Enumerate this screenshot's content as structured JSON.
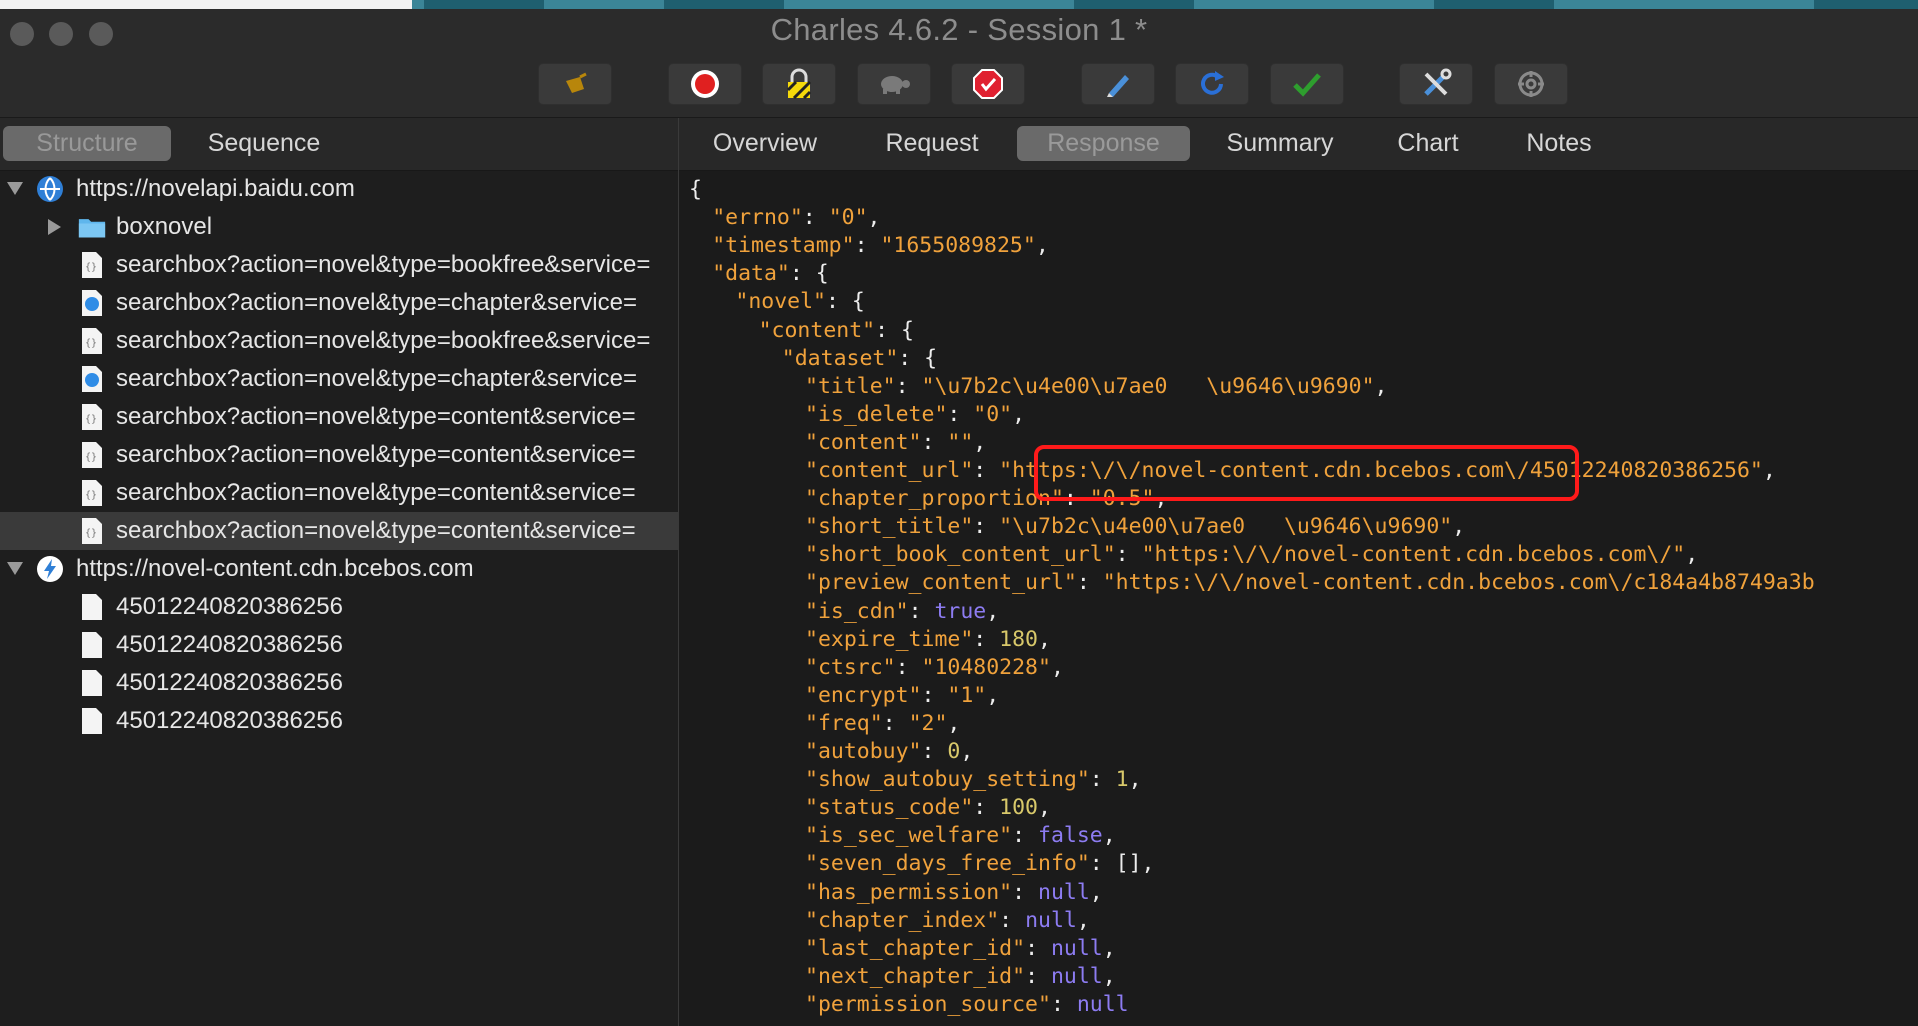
{
  "window": {
    "title": "Charles 4.6.2 - Session 1 *"
  },
  "toolbar": {
    "buttons": [
      {
        "name": "broom-icon",
        "color": "#b8860b"
      },
      {
        "name": "record-icon",
        "color": "#e02020"
      },
      {
        "name": "ssl-proxy-lock-icon",
        "color": "#f5d90a"
      },
      {
        "name": "throttle-turtle-icon",
        "color": "#7a7a7a"
      },
      {
        "name": "breakpoints-stop-icon",
        "color": "#e02030"
      },
      {
        "name": "compose-pen-icon",
        "color": "#4a90d9"
      },
      {
        "name": "repeat-refresh-icon",
        "color": "#2a6fd6"
      },
      {
        "name": "validate-check-icon",
        "color": "#2e9e2e"
      },
      {
        "name": "tools-icon",
        "color": "#4a90d9"
      },
      {
        "name": "settings-gear-icon",
        "color": "#8a8a8a"
      }
    ]
  },
  "left": {
    "tabs": [
      {
        "label": "Structure",
        "active": true
      },
      {
        "label": "Sequence",
        "active": false
      }
    ],
    "tree": [
      {
        "level": 0,
        "label": "https://novelapi.baidu.com",
        "icon": "globe-icon",
        "expanded": true
      },
      {
        "level": 1,
        "label": "boxnovel",
        "icon": "folder-icon",
        "expanded": false
      },
      {
        "level": 1,
        "label": "searchbox?action=novel&type=bookfree&service=",
        "icon": "json-file-icon"
      },
      {
        "level": 1,
        "label": "searchbox?action=novel&type=chapter&service=",
        "icon": "pending-request-icon"
      },
      {
        "level": 1,
        "label": "searchbox?action=novel&type=bookfree&service=",
        "icon": "json-file-icon"
      },
      {
        "level": 1,
        "label": "searchbox?action=novel&type=chapter&service=",
        "icon": "pending-request-icon"
      },
      {
        "level": 1,
        "label": "searchbox?action=novel&type=content&service=",
        "icon": "json-file-icon"
      },
      {
        "level": 1,
        "label": "searchbox?action=novel&type=content&service=",
        "icon": "json-file-icon"
      },
      {
        "level": 1,
        "label": "searchbox?action=novel&type=content&service=",
        "icon": "json-file-icon"
      },
      {
        "level": 1,
        "label": "searchbox?action=novel&type=content&service=",
        "icon": "json-file-icon",
        "selected": true
      },
      {
        "level": 0,
        "label": "https://novel-content.cdn.bcebos.com",
        "icon": "bolt-icon",
        "expanded": true
      },
      {
        "level": 1,
        "label": "45012240820386256",
        "icon": "file-icon"
      },
      {
        "level": 1,
        "label": "45012240820386256",
        "icon": "file-icon"
      },
      {
        "level": 1,
        "label": "45012240820386256",
        "icon": "file-icon"
      },
      {
        "level": 1,
        "label": "45012240820386256",
        "icon": "file-icon"
      }
    ]
  },
  "right": {
    "tabs": [
      {
        "label": "Overview",
        "active": false
      },
      {
        "label": "Request",
        "active": false
      },
      {
        "label": "Response",
        "active": true
      },
      {
        "label": "Summary",
        "active": false
      },
      {
        "label": "Chart",
        "active": false
      },
      {
        "label": "Notes",
        "active": false
      }
    ],
    "json_lines": [
      {
        "indent": 0,
        "tokens": [
          [
            "p",
            "{"
          ]
        ]
      },
      {
        "indent": 1,
        "tokens": [
          [
            "k",
            "\"errno\""
          ],
          [
            "p",
            ": "
          ],
          [
            "s",
            "\"0\""
          ],
          [
            "p",
            ","
          ]
        ]
      },
      {
        "indent": 1,
        "tokens": [
          [
            "k",
            "\"timestamp\""
          ],
          [
            "p",
            ": "
          ],
          [
            "s",
            "\"1655089825\""
          ],
          [
            "p",
            ","
          ]
        ]
      },
      {
        "indent": 1,
        "tokens": [
          [
            "k",
            "\"data\""
          ],
          [
            "p",
            ": {"
          ]
        ]
      },
      {
        "indent": 2,
        "tokens": [
          [
            "k",
            "\"novel\""
          ],
          [
            "p",
            ": {"
          ]
        ]
      },
      {
        "indent": 3,
        "tokens": [
          [
            "k",
            "\"content\""
          ],
          [
            "p",
            ": {"
          ]
        ]
      },
      {
        "indent": 4,
        "tokens": [
          [
            "k",
            "\"dataset\""
          ],
          [
            "p",
            ": {"
          ]
        ]
      },
      {
        "indent": 5,
        "tokens": [
          [
            "k",
            "\"title\""
          ],
          [
            "p",
            ": "
          ],
          [
            "s",
            "\"\\u7b2c\\u4e00\\u7ae0   \\u9646\\u9690\""
          ],
          [
            "p",
            ","
          ]
        ]
      },
      {
        "indent": 5,
        "tokens": [
          [
            "k",
            "\"is_delete\""
          ],
          [
            "p",
            ": "
          ],
          [
            "s",
            "\"0\""
          ],
          [
            "p",
            ","
          ]
        ]
      },
      {
        "indent": 5,
        "tokens": [
          [
            "k",
            "\"content\""
          ],
          [
            "p",
            ": "
          ],
          [
            "s",
            "\"\""
          ],
          [
            "p",
            ","
          ]
        ]
      },
      {
        "indent": 5,
        "tokens": [
          [
            "k",
            "\"content_url\""
          ],
          [
            "p",
            ": "
          ],
          [
            "s",
            "\"https:\\/\\/novel-content.cdn.bcebos.com\\/45012240820386256\""
          ],
          [
            "p",
            ","
          ]
        ]
      },
      {
        "indent": 5,
        "tokens": [
          [
            "k",
            "\"chapter_proportion\""
          ],
          [
            "p",
            ": "
          ],
          [
            "s",
            "\"0.5\""
          ],
          [
            "p",
            ","
          ]
        ]
      },
      {
        "indent": 5,
        "tokens": [
          [
            "k",
            "\"short_title\""
          ],
          [
            "p",
            ": "
          ],
          [
            "s",
            "\"\\u7b2c\\u4e00\\u7ae0   \\u9646\\u9690\""
          ],
          [
            "p",
            ","
          ]
        ]
      },
      {
        "indent": 5,
        "tokens": [
          [
            "k",
            "\"short_book_content_url\""
          ],
          [
            "p",
            ": "
          ],
          [
            "s",
            "\"https:\\/\\/novel-content.cdn.bcebos.com\\/\""
          ],
          [
            "p",
            ","
          ]
        ]
      },
      {
        "indent": 5,
        "tokens": [
          [
            "k",
            "\"preview_content_url\""
          ],
          [
            "p",
            ": "
          ],
          [
            "s",
            "\"https:\\/\\/novel-content.cdn.bcebos.com\\/c184a4b8749a3b"
          ]
        ]
      },
      {
        "indent": 5,
        "tokens": [
          [
            "k",
            "\"is_cdn\""
          ],
          [
            "p",
            ": "
          ],
          [
            "lit",
            "true"
          ],
          [
            "p",
            ","
          ]
        ]
      },
      {
        "indent": 5,
        "tokens": [
          [
            "k",
            "\"expire_time\""
          ],
          [
            "p",
            ": "
          ],
          [
            "n",
            "180"
          ],
          [
            "p",
            ","
          ]
        ]
      },
      {
        "indent": 5,
        "tokens": [
          [
            "k",
            "\"ctsrc\""
          ],
          [
            "p",
            ": "
          ],
          [
            "s",
            "\"10480228\""
          ],
          [
            "p",
            ","
          ]
        ]
      },
      {
        "indent": 5,
        "tokens": [
          [
            "k",
            "\"encrypt\""
          ],
          [
            "p",
            ": "
          ],
          [
            "s",
            "\"1\""
          ],
          [
            "p",
            ","
          ]
        ]
      },
      {
        "indent": 5,
        "tokens": [
          [
            "k",
            "\"freq\""
          ],
          [
            "p",
            ": "
          ],
          [
            "s",
            "\"2\""
          ],
          [
            "p",
            ","
          ]
        ]
      },
      {
        "indent": 5,
        "tokens": [
          [
            "k",
            "\"autobuy\""
          ],
          [
            "p",
            ": "
          ],
          [
            "n",
            "0"
          ],
          [
            "p",
            ","
          ]
        ]
      },
      {
        "indent": 5,
        "tokens": [
          [
            "k",
            "\"show_autobuy_setting\""
          ],
          [
            "p",
            ": "
          ],
          [
            "n",
            "1"
          ],
          [
            "p",
            ","
          ]
        ]
      },
      {
        "indent": 5,
        "tokens": [
          [
            "k",
            "\"status_code\""
          ],
          [
            "p",
            ": "
          ],
          [
            "n",
            "100"
          ],
          [
            "p",
            ","
          ]
        ]
      },
      {
        "indent": 5,
        "tokens": [
          [
            "k",
            "\"is_sec_welfare\""
          ],
          [
            "p",
            ": "
          ],
          [
            "lit",
            "false"
          ],
          [
            "p",
            ","
          ]
        ]
      },
      {
        "indent": 5,
        "tokens": [
          [
            "k",
            "\"seven_days_free_info\""
          ],
          [
            "p",
            ": [],"
          ]
        ]
      },
      {
        "indent": 5,
        "tokens": [
          [
            "k",
            "\"has_permission\""
          ],
          [
            "p",
            ": "
          ],
          [
            "lit",
            "null"
          ],
          [
            "p",
            ","
          ]
        ]
      },
      {
        "indent": 5,
        "tokens": [
          [
            "k",
            "\"chapter_index\""
          ],
          [
            "p",
            ": "
          ],
          [
            "lit",
            "null"
          ],
          [
            "p",
            ","
          ]
        ]
      },
      {
        "indent": 5,
        "tokens": [
          [
            "k",
            "\"last_chapter_id\""
          ],
          [
            "p",
            ": "
          ],
          [
            "lit",
            "null"
          ],
          [
            "p",
            ","
          ]
        ]
      },
      {
        "indent": 5,
        "tokens": [
          [
            "k",
            "\"next_chapter_id\""
          ],
          [
            "p",
            ": "
          ],
          [
            "lit",
            "null"
          ],
          [
            "p",
            ","
          ]
        ]
      },
      {
        "indent": 5,
        "tokens": [
          [
            "k",
            "\"permission_source\""
          ],
          [
            "p",
            ": "
          ],
          [
            "lit",
            "null"
          ]
        ]
      }
    ],
    "highlight_color": "#ff1a1a"
  }
}
